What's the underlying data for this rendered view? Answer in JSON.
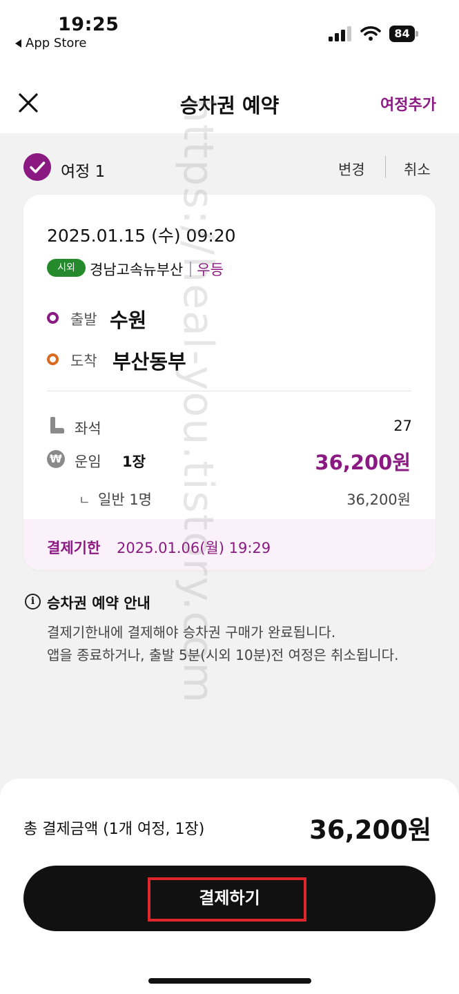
{
  "status_bar": {
    "time": "19:25",
    "back_label": "App Store",
    "battery": "84"
  },
  "header": {
    "title": "승차권 예약",
    "add_trip_label": "여정추가"
  },
  "trip": {
    "title": "여정 1",
    "change_label": "변경",
    "cancel_label": "취소",
    "departure_datetime": "2025.01.15 (수) 09:20",
    "route_badge": "시외",
    "company": "경남고속뉴부산",
    "grade": "우등",
    "departure_label": "출발",
    "departure_station": "수원",
    "arrival_label": "도착",
    "arrival_station": "부산동부",
    "seat_label": "좌석",
    "seat_number": "27",
    "fare_icon": "₩",
    "fare_label": "운임",
    "fare_qty": "1장",
    "fare_total": "36,200원",
    "fare_sub_mark": "ㄴ",
    "fare_sub_label": "일반 1명",
    "fare_sub_amount": "36,200원",
    "deadline_label": "결제기한",
    "deadline_value": "2025.01.06(월) 19:29"
  },
  "notice": {
    "icon": "i",
    "title": "승차권 예약 안내",
    "line1": "결제기한내에 결제해야 승차권 구매가 완료됩니다.",
    "line2": "앱을 종료하거나, 출발 5분(시외 10분)전 여정은 취소됩니다."
  },
  "bottom": {
    "total_label": "총 결제금액 (1개 여정, 1장)",
    "total_amount": "36,200원",
    "pay_label": "결제하기"
  },
  "watermark": "https://heal-you.tistory.com",
  "colors": {
    "accent": "#8a1a82",
    "route_badge": "#248a2b",
    "arrival_dot": "#d96a1f",
    "highlight": "#e0262b"
  }
}
